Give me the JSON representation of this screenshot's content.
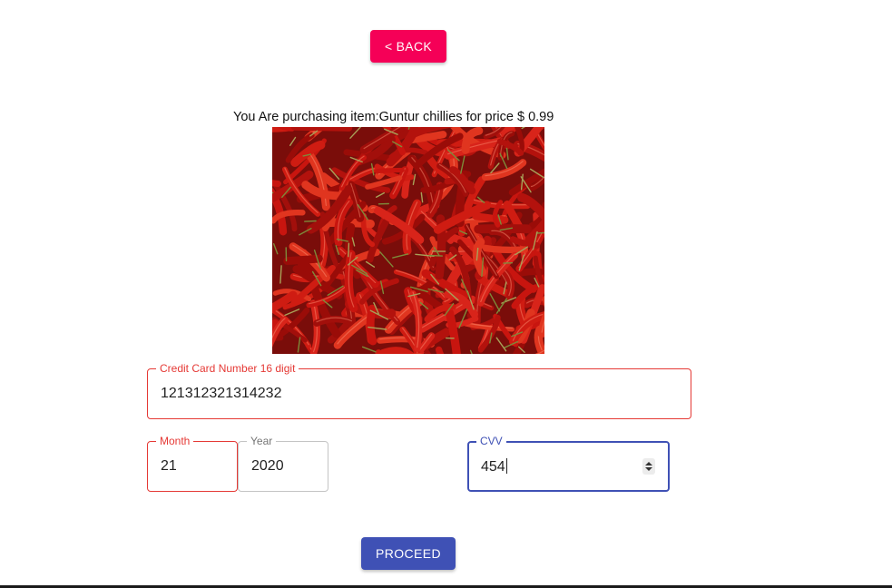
{
  "header": {
    "back_label": "< BACK"
  },
  "purchase": {
    "message": "You Are purchasing item:Guntur chillies for price $ 0.99",
    "image_subject": "red chillies"
  },
  "form": {
    "card_number": {
      "label": "Credit Card Number 16 digit",
      "value": "121312321314232"
    },
    "month": {
      "label": "Month",
      "value": "21"
    },
    "year": {
      "label": "Year",
      "value": "2020"
    },
    "cvv": {
      "label": "CVV",
      "value": "454"
    },
    "proceed_label": "PROCEED"
  },
  "colors": {
    "back_button": "#f50057",
    "primary": "#3f51b5",
    "error": "#e53935",
    "chilli_red": "#c8150f"
  }
}
